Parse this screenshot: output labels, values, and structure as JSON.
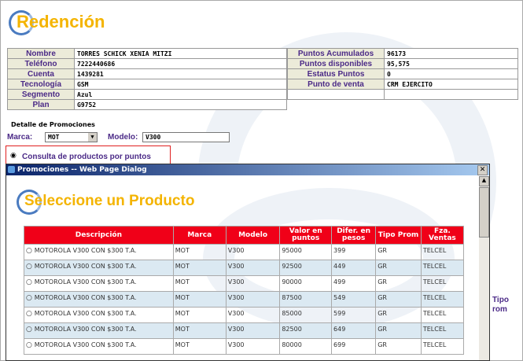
{
  "page": {
    "title": "Redención",
    "info_left": [
      {
        "label": "Nombre",
        "value": "TORRES SCHICK XENIA MITZI"
      },
      {
        "label": "Teléfono",
        "value": "7222440686"
      },
      {
        "label": "Cuenta",
        "value": "1439281"
      },
      {
        "label": "Tecnología",
        "value": "GSM"
      },
      {
        "label": "Segmento",
        "value": "Azul"
      },
      {
        "label": "Plan",
        "value": "G9752"
      }
    ],
    "info_right": [
      {
        "label": "Puntos Acumulados",
        "value": "96173"
      },
      {
        "label": "Puntos disponibles",
        "value": "95,575"
      },
      {
        "label": "Estatus Puntos",
        "value": "0"
      },
      {
        "label": "Punto de venta",
        "value": "CRM EJERCITO"
      }
    ],
    "detalle_label": "Detalle de Promociones",
    "marca_label": "Marca:",
    "marca_value": "MOT",
    "modelo_label": "Modelo:",
    "modelo_value": "V300",
    "consulta_label": "Consulta de productos por puntos",
    "behind_header": "Tipo\nrom"
  },
  "dialog": {
    "title": "Promociones -- Web Page Dialog",
    "heading": "Seleccione un Producto",
    "columns": [
      "Descripción",
      "Marca",
      "Modelo",
      "Valor en puntos",
      "Difer. en pesos",
      "Tipo Prom",
      "Fza. Ventas"
    ],
    "rows": [
      [
        "MOTOROLA V300 CON $300 T.A.",
        "MOT",
        "V300",
        "95000",
        "399",
        "GR",
        "TELCEL"
      ],
      [
        "MOTOROLA V300 CON $300 T.A.",
        "MOT",
        "V300",
        "92500",
        "449",
        "GR",
        "TELCEL"
      ],
      [
        "MOTOROLA V300 CON $300 T.A.",
        "MOT",
        "V300",
        "90000",
        "499",
        "GR",
        "TELCEL"
      ],
      [
        "MOTOROLA V300 CON $300 T.A.",
        "MOT",
        "V300",
        "87500",
        "549",
        "GR",
        "TELCEL"
      ],
      [
        "MOTOROLA V300 CON $300 T.A.",
        "MOT",
        "V300",
        "85000",
        "599",
        "GR",
        "TELCEL"
      ],
      [
        "MOTOROLA V300 CON $300 T.A.",
        "MOT",
        "V300",
        "82500",
        "649",
        "GR",
        "TELCEL"
      ],
      [
        "MOTOROLA V300 CON $300 T.A.",
        "MOT",
        "V300",
        "80000",
        "699",
        "GR",
        "TELCEL"
      ]
    ]
  }
}
